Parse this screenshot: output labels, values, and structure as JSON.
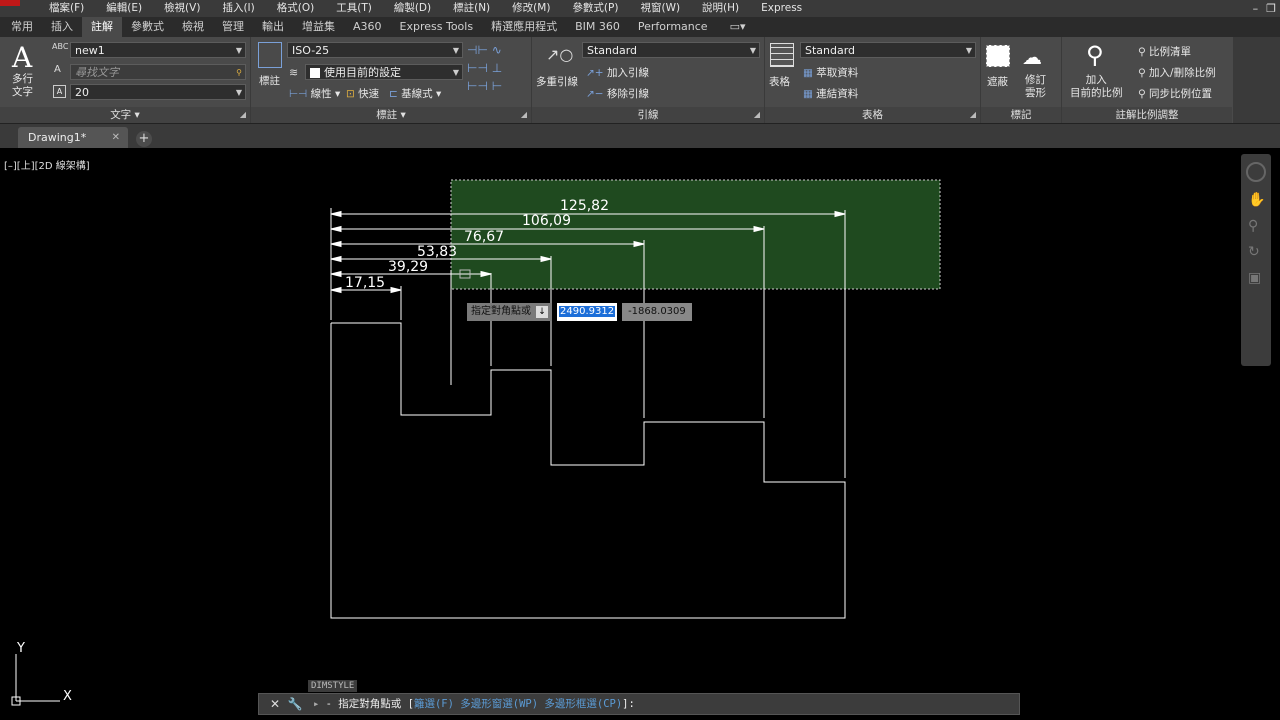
{
  "menu": [
    "檔案(F)",
    "編輯(E)",
    "檢視(V)",
    "插入(I)",
    "格式(O)",
    "工具(T)",
    "繪製(D)",
    "標註(N)",
    "修改(M)",
    "參數式(P)",
    "視窗(W)",
    "說明(H)",
    "Express"
  ],
  "window_controls": [
    "–",
    "❐"
  ],
  "ribbon_tabs": [
    "常用",
    "插入",
    "註解",
    "參數式",
    "檢視",
    "管理",
    "輸出",
    "增益集",
    "A360",
    "Express Tools",
    "精選應用程式",
    "BIM 360",
    "Performance"
  ],
  "active_tab": "註解",
  "text_panel": {
    "big_label": "多行\n文字",
    "style_value": "new1",
    "find_placeholder": "尋找文字",
    "height_value": "20",
    "title": "文字"
  },
  "dim_panel": {
    "big_label": "標註",
    "style_value": "ISO-25",
    "layer_value": "使用目前的設定",
    "linear": "線性",
    "quick": "快速",
    "baseline": "基線式",
    "title": "標註"
  },
  "leader_panel": {
    "big_label": "多重引線",
    "style_value": "Standard",
    "add": "加入引線",
    "remove": "移除引線",
    "title": "引線"
  },
  "table_panel": {
    "big_label": "表格",
    "style_value": "Standard",
    "extract": "萃取資料",
    "link": "連結資料",
    "title": "表格"
  },
  "markup_panel": {
    "wipeout": "遮蔽",
    "revcloud": "修訂\n雲形",
    "title": "標記"
  },
  "scale_panel": {
    "add_current": "加入\n目前的比例",
    "scale_list": "比例清單",
    "add_delete": "加入/刪除比例",
    "sync": "同步比例位置",
    "title": "註解比例調整"
  },
  "doc_tab": "Drawing1*",
  "view_label": "[–][上][2D 線架構]",
  "dimensions": [
    "125,82",
    "106,09",
    "76,67",
    "53,83",
    "39,29",
    "17,15"
  ],
  "dynamic_input": {
    "prompt": "指定對角點或",
    "x_value": "2490.9312",
    "y_value": "-1868.0309"
  },
  "command": {
    "label": "DIMSTYLE",
    "prefix": "- 指定對角點或 [",
    "opt1": "籬選(F)",
    "opt2": "多邊形窗選(WP)",
    "opt3": "多邊形框選(CP)",
    "suffix": "]:"
  },
  "ucs": {
    "y": "Y",
    "x": "X"
  },
  "colors": {
    "selection": "#1f4a1f",
    "background": "#000000",
    "ribbon": "#4a4a4a"
  }
}
